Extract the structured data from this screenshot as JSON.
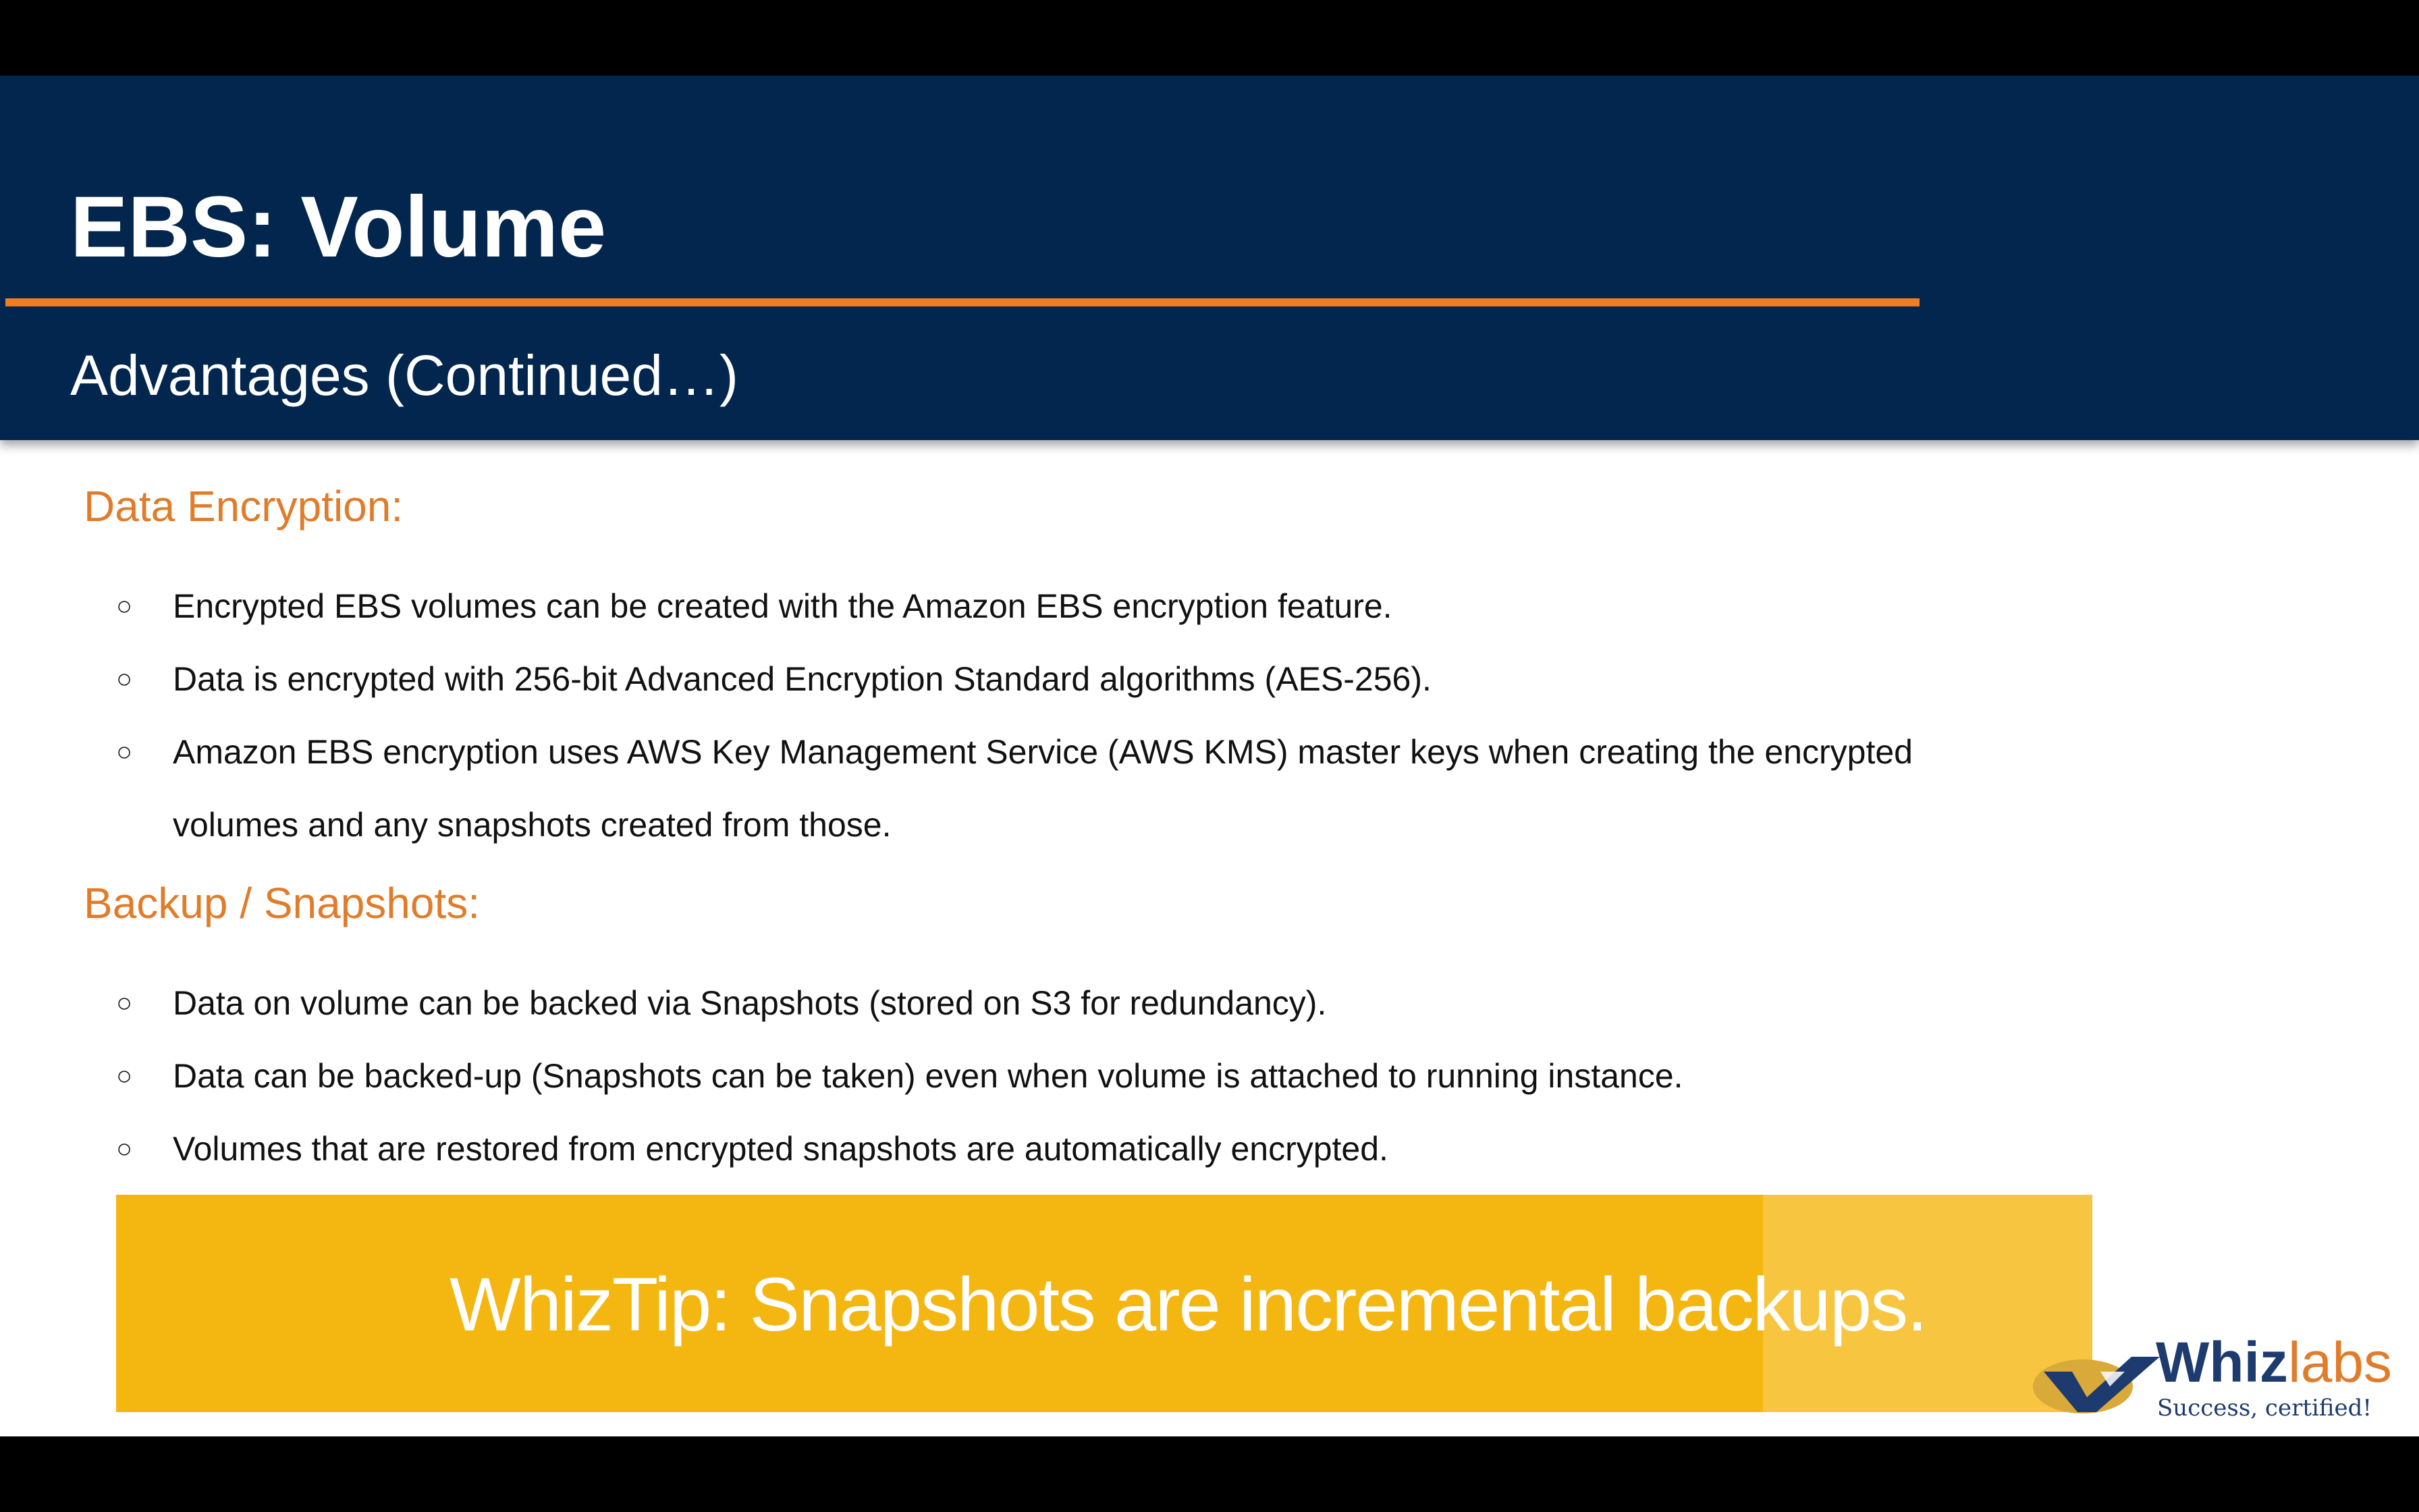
{
  "header": {
    "title": "EBS: Volume",
    "subtitle": "Advantages (Continued…)"
  },
  "sections": [
    {
      "heading": "Data Encryption:",
      "bullets": [
        "Encrypted EBS volumes can be created with the Amazon EBS encryption feature.",
        "Data is encrypted with 256-bit Advanced Encryption Standard algorithms (AES-256).",
        "Amazon EBS encryption uses AWS Key Management Service (AWS KMS) master keys when creating the encrypted",
        "volumes and any snapshots created from those."
      ]
    },
    {
      "heading": "Backup / Snapshots:",
      "bullets": [
        "Data on volume can be backed via Snapshots (stored on S3 for redundancy).",
        "Data can be backed-up (Snapshots can be taken) even when volume is attached to running instance.",
        "Volumes that are restored from encrypted snapshots are automatically encrypted."
      ]
    }
  ],
  "bullet_marker": "○",
  "tip": {
    "text": "WhizTip: Snapshots are incremental backups."
  },
  "logo": {
    "word_part1": "Whiz",
    "word_part2": "labs",
    "tagline": "Success, certified!",
    "icon": "whizlabs-logo-mark"
  },
  "colors": {
    "header_bg": "#02264d",
    "accent_orange": "#ef7d22",
    "heading_orange": "#e07c2a",
    "tip_yellow": "#f4b611"
  }
}
